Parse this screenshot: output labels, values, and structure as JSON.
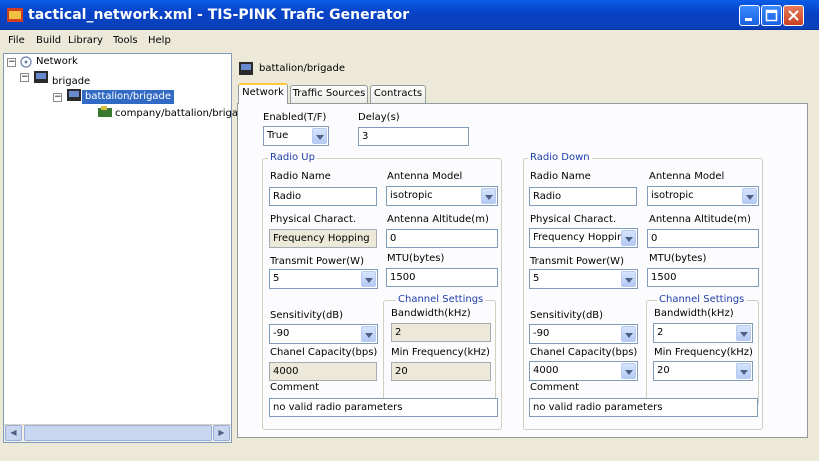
{
  "window": {
    "title": "tactical_network.xml - TIS-PINK Trafic Generator"
  },
  "menu": [
    "File",
    "Build",
    "Library",
    "Tools",
    "Help"
  ],
  "tree": {
    "root": "Network",
    "level1": "brigade",
    "level2": "battalion/brigade",
    "level3": "company/battalion/brigade"
  },
  "node_title": "battalion/brigade",
  "tabs": [
    "Network",
    "Traffic Sources",
    "Contracts"
  ],
  "general": {
    "enabled_label": "Enabled(T/F)",
    "enabled_value": "True",
    "delay_label": "Delay(s)",
    "delay_value": "3"
  },
  "radio_up": {
    "title": "Radio Up",
    "radio_name_label": "Radio Name",
    "radio_name_value": "Radio",
    "antenna_model_label": "Antenna Model",
    "antenna_model_value": "isotropic",
    "physical_label": "Physical Charact.",
    "physical_value": "Frequency Hopping",
    "antenna_alt_label": "Antenna Altitude(m)",
    "antenna_alt_value": "0",
    "transmit_label": "Transmit Power(W)",
    "transmit_value": "5",
    "mtu_label": "MTU(bytes)",
    "mtu_value": "1500",
    "channel_title": "Channel Settings",
    "sensitivity_label": "Sensitivity(dB)",
    "sensitivity_value": "-90",
    "bandwidth_label": "Bandwidth(kHz)",
    "bandwidth_value": "2",
    "capacity_label": "Chanel Capacity(bps)",
    "capacity_value": "4000",
    "minfreq_label": "Min Frequency(kHz)",
    "minfreq_value": "20",
    "comment_label": "Comment",
    "comment_value": "no valid radio parameters"
  },
  "radio_down": {
    "title": "Radio Down",
    "radio_name_label": "Radio Name",
    "radio_name_value": "Radio",
    "antenna_model_label": "Antenna Model",
    "antenna_model_value": "isotropic",
    "physical_label": "Physical Charact.",
    "physical_value": "Frequency Hoppin",
    "antenna_alt_label": "Antenna Altitude(m)",
    "antenna_alt_value": "0",
    "transmit_label": "Transmit Power(W)",
    "transmit_value": "5",
    "mtu_label": "MTU(bytes)",
    "mtu_value": "1500",
    "channel_title": "Channel Settings",
    "sensitivity_label": "Sensitivity(dB)",
    "sensitivity_value": "-90",
    "bandwidth_label": "Bandwidth(kHz)",
    "bandwidth_value": "2",
    "capacity_label": "Chanel Capacity(bps)",
    "capacity_value": "4000",
    "minfreq_label": "Min Frequency(kHz)",
    "minfreq_value": "20",
    "comment_label": "Comment",
    "comment_value": "no valid radio parameters"
  },
  "colors": {
    "titlebar": "#0a5ee8",
    "tree_selection": "#316ac5",
    "group_title": "#1e3ea8"
  }
}
